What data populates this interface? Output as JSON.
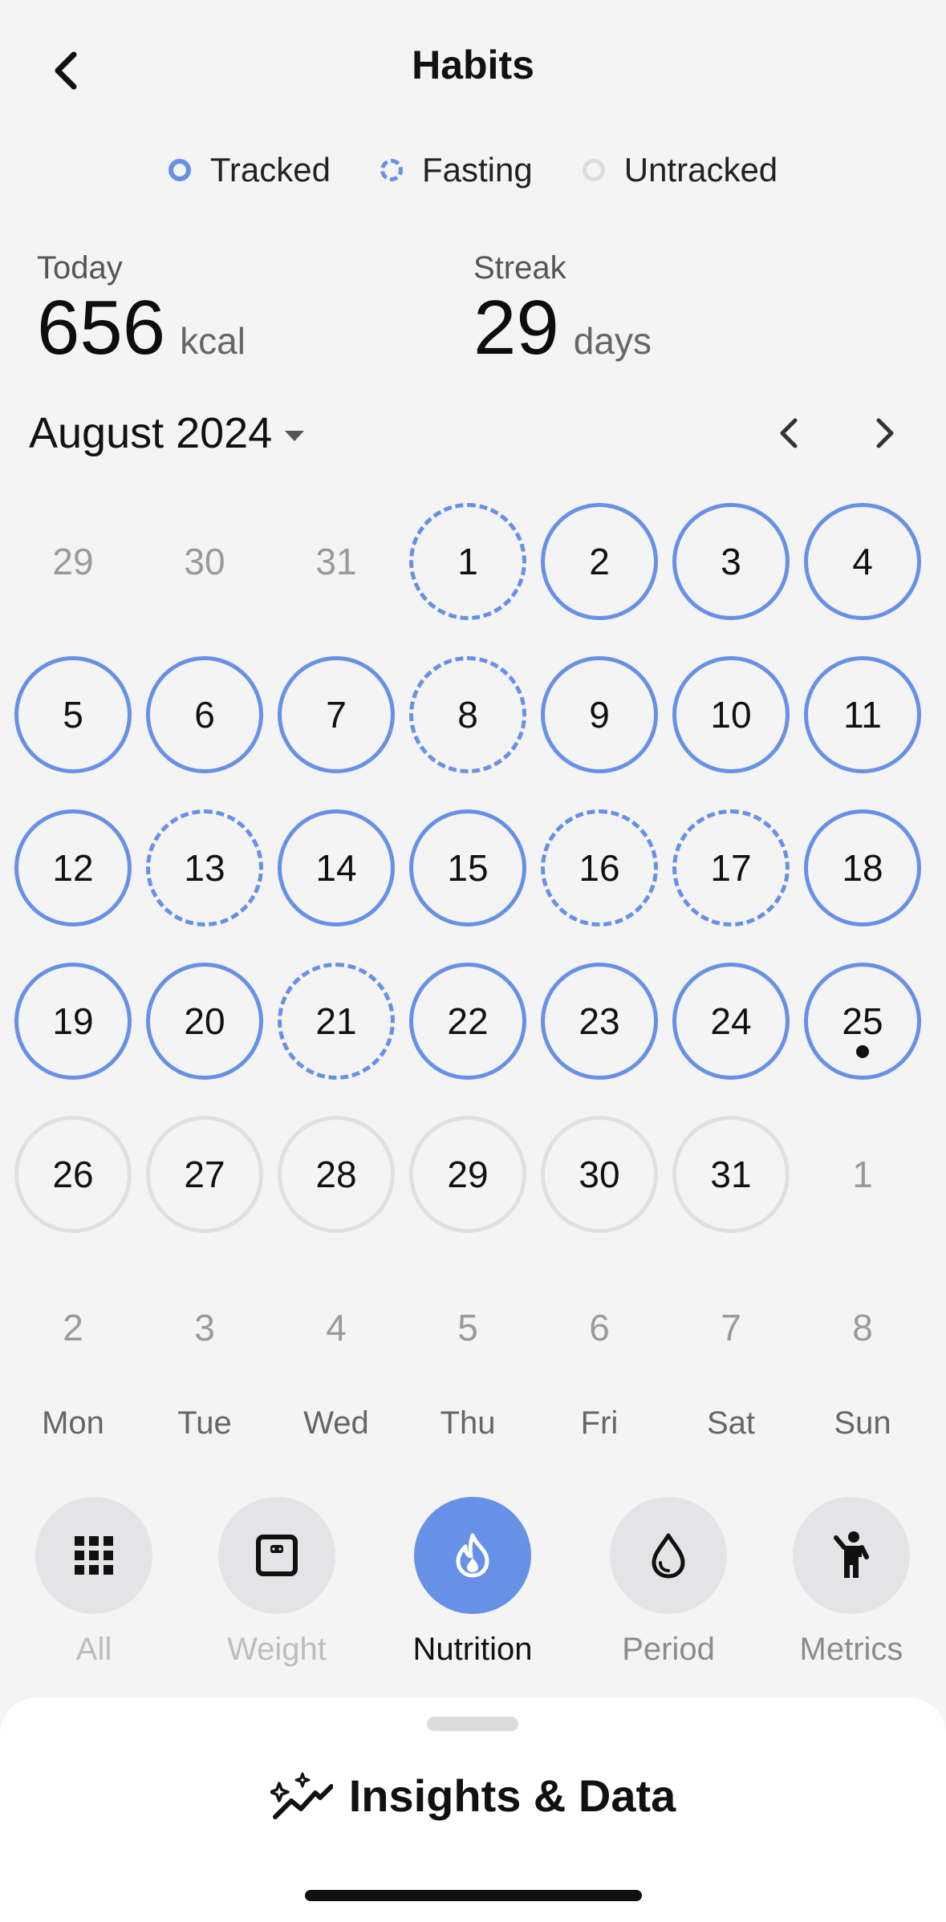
{
  "header": {
    "title": "Habits"
  },
  "legend": {
    "tracked": "Tracked",
    "fasting": "Fasting",
    "untracked": "Untracked"
  },
  "stats": {
    "today": {
      "label": "Today",
      "value": "656",
      "unit": "kcal"
    },
    "streak": {
      "label": "Streak",
      "value": "29",
      "unit": "days"
    }
  },
  "calendar": {
    "month_label": "August 2024",
    "weeks": [
      [
        {
          "d": "29",
          "s": "outside"
        },
        {
          "d": "30",
          "s": "outside"
        },
        {
          "d": "31",
          "s": "outside"
        },
        {
          "d": "1",
          "s": "fasting"
        },
        {
          "d": "2",
          "s": "tracked"
        },
        {
          "d": "3",
          "s": "tracked"
        },
        {
          "d": "4",
          "s": "tracked"
        }
      ],
      [
        {
          "d": "5",
          "s": "tracked"
        },
        {
          "d": "6",
          "s": "tracked"
        },
        {
          "d": "7",
          "s": "tracked"
        },
        {
          "d": "8",
          "s": "fasting"
        },
        {
          "d": "9",
          "s": "tracked"
        },
        {
          "d": "10",
          "s": "tracked"
        },
        {
          "d": "11",
          "s": "tracked"
        }
      ],
      [
        {
          "d": "12",
          "s": "tracked"
        },
        {
          "d": "13",
          "s": "fasting"
        },
        {
          "d": "14",
          "s": "tracked"
        },
        {
          "d": "15",
          "s": "tracked"
        },
        {
          "d": "16",
          "s": "fasting"
        },
        {
          "d": "17",
          "s": "fasting"
        },
        {
          "d": "18",
          "s": "tracked"
        }
      ],
      [
        {
          "d": "19",
          "s": "tracked"
        },
        {
          "d": "20",
          "s": "tracked"
        },
        {
          "d": "21",
          "s": "fasting"
        },
        {
          "d": "22",
          "s": "tracked"
        },
        {
          "d": "23",
          "s": "tracked"
        },
        {
          "d": "24",
          "s": "tracked"
        },
        {
          "d": "25",
          "s": "tracked",
          "today": true
        }
      ],
      [
        {
          "d": "26",
          "s": "untracked"
        },
        {
          "d": "27",
          "s": "untracked"
        },
        {
          "d": "28",
          "s": "untracked"
        },
        {
          "d": "29",
          "s": "untracked"
        },
        {
          "d": "30",
          "s": "untracked"
        },
        {
          "d": "31",
          "s": "untracked"
        },
        {
          "d": "1",
          "s": "outside"
        }
      ],
      [
        {
          "d": "2",
          "s": "outside"
        },
        {
          "d": "3",
          "s": "outside"
        },
        {
          "d": "4",
          "s": "outside"
        },
        {
          "d": "5",
          "s": "outside"
        },
        {
          "d": "6",
          "s": "outside"
        },
        {
          "d": "7",
          "s": "outside"
        },
        {
          "d": "8",
          "s": "outside"
        }
      ]
    ],
    "weekdays": [
      "Mon",
      "Tue",
      "Wed",
      "Thu",
      "Fri",
      "Sat",
      "Sun"
    ]
  },
  "categories": [
    {
      "label": "All",
      "icon": "grid-icon"
    },
    {
      "label": "Weight",
      "icon": "scale-icon"
    },
    {
      "label": "Nutrition",
      "icon": "flame-icon",
      "active": true
    },
    {
      "label": "Period",
      "icon": "drop-icon"
    },
    {
      "label": "Metrics",
      "icon": "person-icon"
    }
  ],
  "sheet": {
    "title": "Insights & Data",
    "icon": "sparkle-chart-icon"
  },
  "colors": {
    "accent": "#6691e6",
    "background": "#f4f4f5",
    "untracked": "#e0e0e0"
  }
}
